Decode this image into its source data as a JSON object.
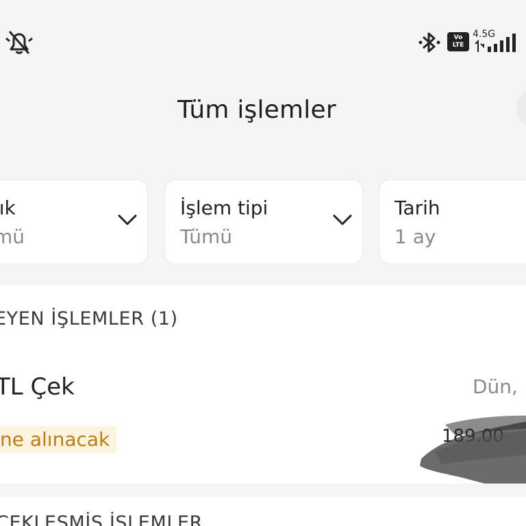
{
  "status_bar": {
    "icons": [
      "notifications-off-icon",
      "bluetooth-icon",
      "volte-icon",
      "signal-icon"
    ],
    "volte_top": "Vo",
    "volte_bottom": "LTE",
    "network": "4.5G"
  },
  "header": {
    "title": "Tüm işlemler"
  },
  "filters": {
    "account": {
      "label": "lık",
      "value": "mü"
    },
    "type": {
      "label": "İşlem tipi",
      "value": "Tümü"
    },
    "date": {
      "label": "Tarih",
      "value": "1 ay"
    }
  },
  "pending": {
    "heading": "EYEN İŞLEMLER (1)",
    "item": {
      "title": "TL Çek",
      "date": "Dün,",
      "status": "ne alınacak",
      "amount": "189.00"
    }
  },
  "completed": {
    "heading": "ÇEKLEŞMİŞ İŞLEMLER"
  },
  "colors": {
    "background": "#f5f5f6",
    "card": "#ffffff",
    "status_text": "#c27a12",
    "status_bg": "#fdf3e1",
    "muted_text": "#8a8a8e"
  }
}
